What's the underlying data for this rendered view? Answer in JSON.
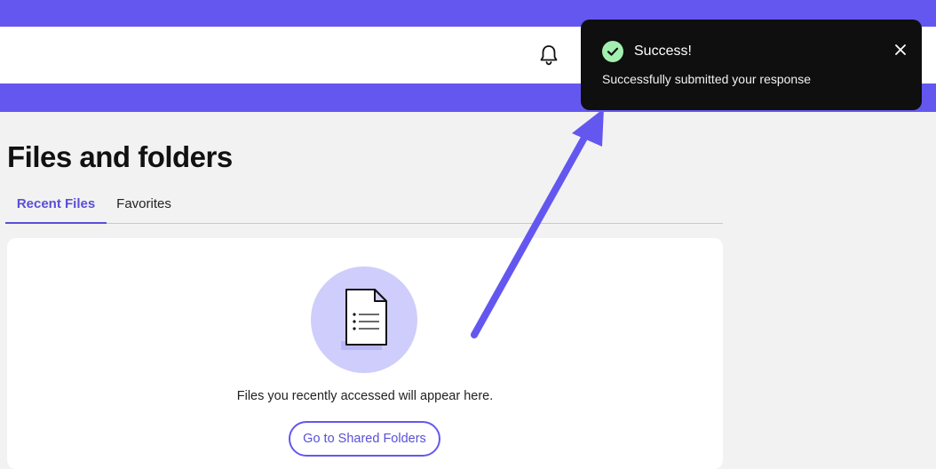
{
  "page": {
    "title": "Files and folders"
  },
  "tabs": [
    {
      "label": "Recent Files",
      "active": true
    },
    {
      "label": "Favorites",
      "active": false
    }
  ],
  "empty_state": {
    "message": "Files you recently accessed will appear here.",
    "button_label": "Go to Shared Folders",
    "icon": "document-icon"
  },
  "header": {
    "icon": "bell-icon"
  },
  "toast": {
    "title": "Success!",
    "message": "Successfully submitted your response",
    "status_icon": "check-circle-icon",
    "close_icon": "close-icon"
  },
  "colors": {
    "brand": "#6457f0",
    "accent_text": "#5a4fd8",
    "toast_bg": "#0e0f0e",
    "success": "#a3efb0",
    "illustration_bg": "#cfcdfb"
  }
}
